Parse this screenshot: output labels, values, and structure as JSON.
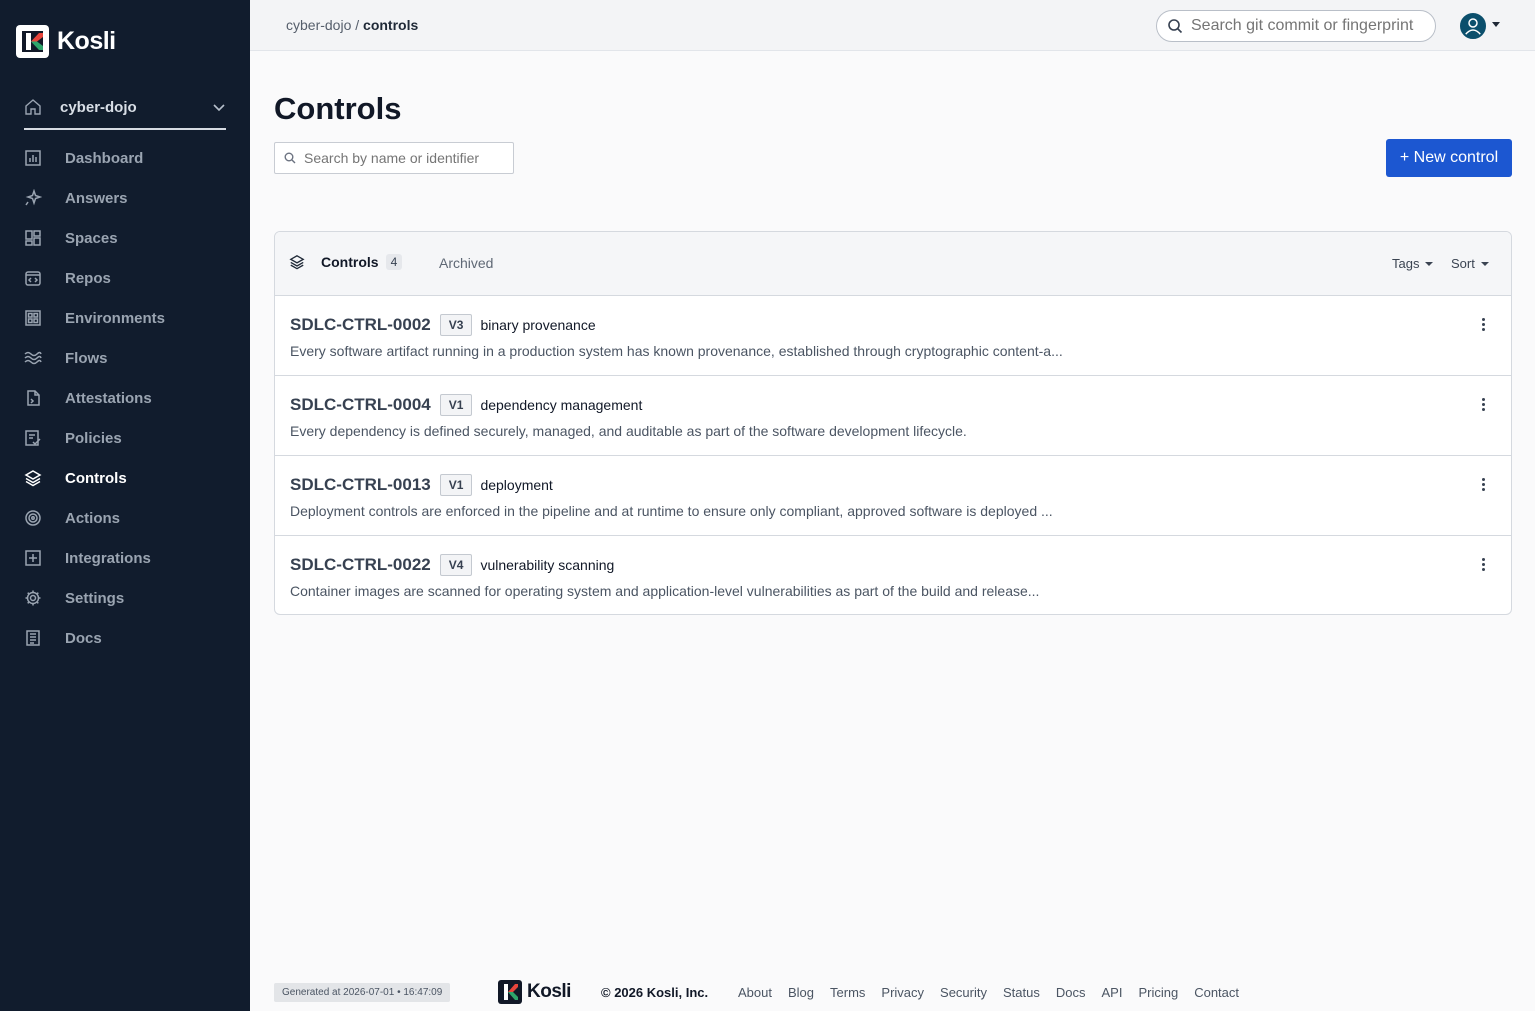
{
  "brand": {
    "name": "Kosli"
  },
  "sidebar": {
    "org": "cyber-dojo",
    "items": [
      {
        "label": "Dashboard",
        "icon": "chart-icon"
      },
      {
        "label": "Answers",
        "icon": "sparkle-icon"
      },
      {
        "label": "Spaces",
        "icon": "spaces-icon"
      },
      {
        "label": "Repos",
        "icon": "repo-icon"
      },
      {
        "label": "Environments",
        "icon": "grid-icon"
      },
      {
        "label": "Flows",
        "icon": "waves-icon"
      },
      {
        "label": "Attestations",
        "icon": "file-icon"
      },
      {
        "label": "Policies",
        "icon": "policy-icon"
      },
      {
        "label": "Controls",
        "icon": "layers-icon",
        "active": true
      },
      {
        "label": "Actions",
        "icon": "target-icon"
      },
      {
        "label": "Integrations",
        "icon": "plus-box-icon"
      },
      {
        "label": "Settings",
        "icon": "gear-icon"
      },
      {
        "label": "Docs",
        "icon": "doc-icon"
      }
    ]
  },
  "topbar": {
    "breadcrumb_org": "cyber-dojo",
    "breadcrumb_sep": " / ",
    "breadcrumb_page": "controls",
    "search_placeholder": "Search git commit or fingerprint"
  },
  "main": {
    "title": "Controls",
    "search_placeholder": "Search by name or identifier",
    "new_button": "+ New control",
    "tabs": {
      "controls_label": "Controls",
      "controls_count": "4",
      "archived_label": "Archived"
    },
    "filters": {
      "tags": "Tags",
      "sort": "Sort"
    },
    "controls": [
      {
        "id": "SDLC-CTRL-0002",
        "version": "V3",
        "name": "binary provenance",
        "description": "Every software artifact running in a production system has known provenance, established through cryptographic content-a..."
      },
      {
        "id": "SDLC-CTRL-0004",
        "version": "V1",
        "name": "dependency management",
        "description": "Every dependency is defined securely, managed, and auditable as part of the software development lifecycle."
      },
      {
        "id": "SDLC-CTRL-0013",
        "version": "V1",
        "name": "deployment",
        "description": "Deployment controls are enforced in the pipeline and at runtime to ensure only compliant, approved software is deployed ..."
      },
      {
        "id": "SDLC-CTRL-0022",
        "version": "V4",
        "name": "vulnerability scanning",
        "description": "Container images are scanned for operating system and application-level vulnerabilities as part of the build and release..."
      }
    ]
  },
  "footer": {
    "generated": "Generated at 2026-07-01 • 16:47:09",
    "brand": "Kosli",
    "copyright": "© 2026 Kosli, Inc.",
    "links": [
      "About",
      "Blog",
      "Terms",
      "Privacy",
      "Security",
      "Status",
      "Docs",
      "API",
      "Pricing",
      "Contact"
    ]
  },
  "colors": {
    "sidebar_bg": "#111c2d",
    "primary": "#1c57d1",
    "logo_red": "#e8453c",
    "logo_green": "#2ea56b"
  }
}
